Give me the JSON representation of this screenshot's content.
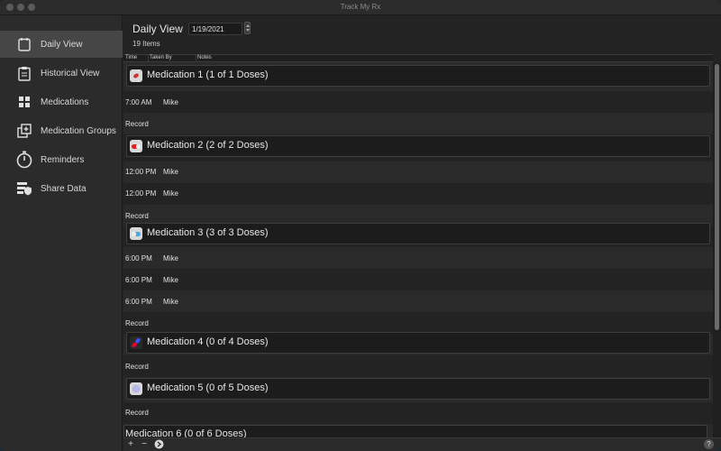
{
  "window": {
    "title": "Track My Rx"
  },
  "sidebar": {
    "items": [
      {
        "label": "Daily View",
        "icon": "calendar-icon",
        "active": true
      },
      {
        "label": "Historical View",
        "icon": "clipboard-icon",
        "active": false
      },
      {
        "label": "Medications",
        "icon": "grid-icon",
        "active": false
      },
      {
        "label": "Medication Groups",
        "icon": "group-add-icon",
        "active": false
      },
      {
        "label": "Reminders",
        "icon": "stopwatch-icon",
        "active": false
      },
      {
        "label": "Share Data",
        "icon": "share-shield-icon",
        "active": false
      }
    ]
  },
  "header": {
    "title": "Daily View",
    "date": "1/19/2021",
    "item_count": "19 Items"
  },
  "columns": {
    "time": "Time",
    "taken_by": "Taken By",
    "notes": "Notes"
  },
  "groups": [
    {
      "name": "Medication 1 (1 of 1 Doses)",
      "icon": "white-pill-icon",
      "doses": [
        {
          "time": "7:00 AM",
          "taken_by": "Mike"
        }
      ],
      "action": "Record"
    },
    {
      "name": "Medication 2 (2 of 2 Doses)",
      "icon": "red-capsule-icon",
      "doses": [
        {
          "time": "12:00 PM",
          "taken_by": "Mike"
        },
        {
          "time": "12:00 PM",
          "taken_by": "Mike"
        }
      ],
      "action": "Record"
    },
    {
      "name": "Medication 3 (3 of 3 Doses)",
      "icon": "blue-capsule-icon",
      "doses": [
        {
          "time": "6:00 PM",
          "taken_by": "Mike"
        },
        {
          "time": "6:00 PM",
          "taken_by": "Mike"
        },
        {
          "time": "6:00 PM",
          "taken_by": "Mike"
        }
      ],
      "action": "Record"
    },
    {
      "name": "Medication 4 (0 of 4 Doses)",
      "icon": "red-blue-capsule-icon",
      "doses": [],
      "action": "Record"
    },
    {
      "name": "Medication 5 (0 of 5 Doses)",
      "icon": "round-tablet-icon",
      "doses": [],
      "action": "Record"
    },
    {
      "name": "Medication 6 (0 of 6 Doses)",
      "icon": "",
      "doses": [],
      "action": ""
    }
  ],
  "bottombar": {
    "add": "+",
    "remove": "−",
    "help": "?"
  }
}
